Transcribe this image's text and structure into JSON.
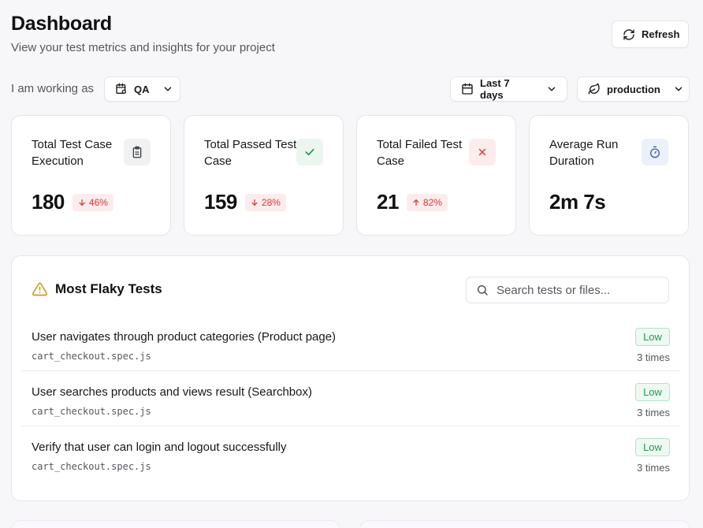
{
  "header": {
    "title": "Dashboard",
    "subtitle": "View your test metrics and insights for your project",
    "refresh_label": "Refresh"
  },
  "filters": {
    "role_label": "I am working as",
    "role_value": "QA",
    "date_range": "Last 7 days",
    "environment": "production"
  },
  "cards": [
    {
      "title": "Total Test Case Execution",
      "value": "180",
      "change": "46%",
      "direction": "down",
      "icon": "clipboard-icon"
    },
    {
      "title": "Total Passed Test Case",
      "value": "159",
      "change": "28%",
      "direction": "down",
      "icon": "check-icon"
    },
    {
      "title": "Total Failed Test Case",
      "value": "21",
      "change": "82%",
      "direction": "up",
      "icon": "x-icon"
    },
    {
      "title": "Average Run Duration",
      "value": "2m 7s",
      "icon": "stopwatch-icon"
    }
  ],
  "flaky": {
    "title": "Most Flaky Tests",
    "search_placeholder": "Search tests or files...",
    "rows": [
      {
        "title": "User navigates through product categories (Product page)",
        "file": "cart_checkout.spec.js",
        "severity": "Low",
        "count": "3 times"
      },
      {
        "title": "User searches products and views result (Searchbox)",
        "file": "cart_checkout.spec.js",
        "severity": "Low",
        "count": "3 times"
      },
      {
        "title": "Verify that user can login and logout successfully",
        "file": "cart_checkout.spec.js",
        "severity": "Low",
        "count": "3 times"
      }
    ]
  },
  "colors": {
    "danger": "#d23a3a",
    "success": "#1f9a50",
    "warning": "#d49a1c",
    "info": "#3b5bb5"
  }
}
